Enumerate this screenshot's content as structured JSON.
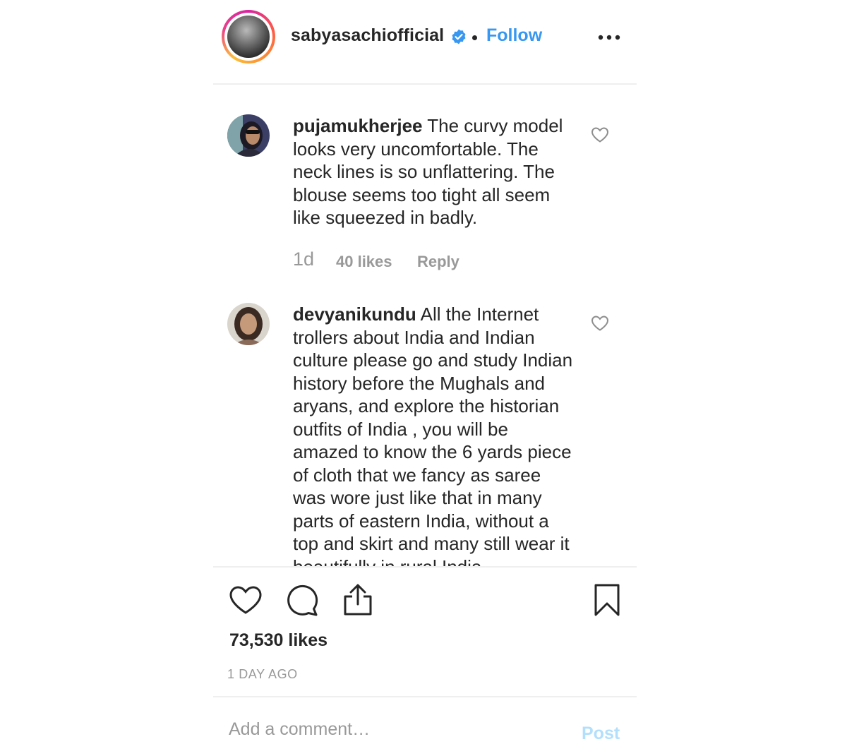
{
  "post": {
    "author": "sabyasachiofficial",
    "follow_label": "Follow",
    "verified_icon": "verified-badge-icon",
    "more_icon": "more-options-icon",
    "total_likes": "73,530 likes",
    "timestamp": "1 DAY AGO"
  },
  "comments": [
    {
      "username": "pujamukherjee",
      "text": " The curvy model\nlooks very uncomfortable. The\nneck lines is so unflattering. The\nblouse seems too tight all seem\nlike squeezed in badly.",
      "time": "1d",
      "likes": "40 likes",
      "reply_label": "Reply"
    },
    {
      "username": "devyanikundu",
      "text": " All the Internet\ntrollers about India and Indian\nculture please go and study Indian\nhistory before the Mughals and\naryans, and explore the historian\noutfits of India , you will be\namazed to know the 6 yards piece\nof cloth that we fancy as saree\nwas wore just like that in many\nparts of eastern India, without a\ntop and skirt and many still wear it\nbeautifully in rural India..."
    }
  ],
  "actions": {
    "like_icon": "heart-icon",
    "comment_icon": "comment-icon",
    "share_icon": "share-icon",
    "save_icon": "bookmark-icon"
  },
  "add_comment": {
    "placeholder": "Add a comment…",
    "post_label": "Post"
  },
  "colors": {
    "accent": "#3897f0",
    "post_disabled": "#b2dffc",
    "muted": "#999999",
    "text": "#262626",
    "divider": "#efefef"
  }
}
